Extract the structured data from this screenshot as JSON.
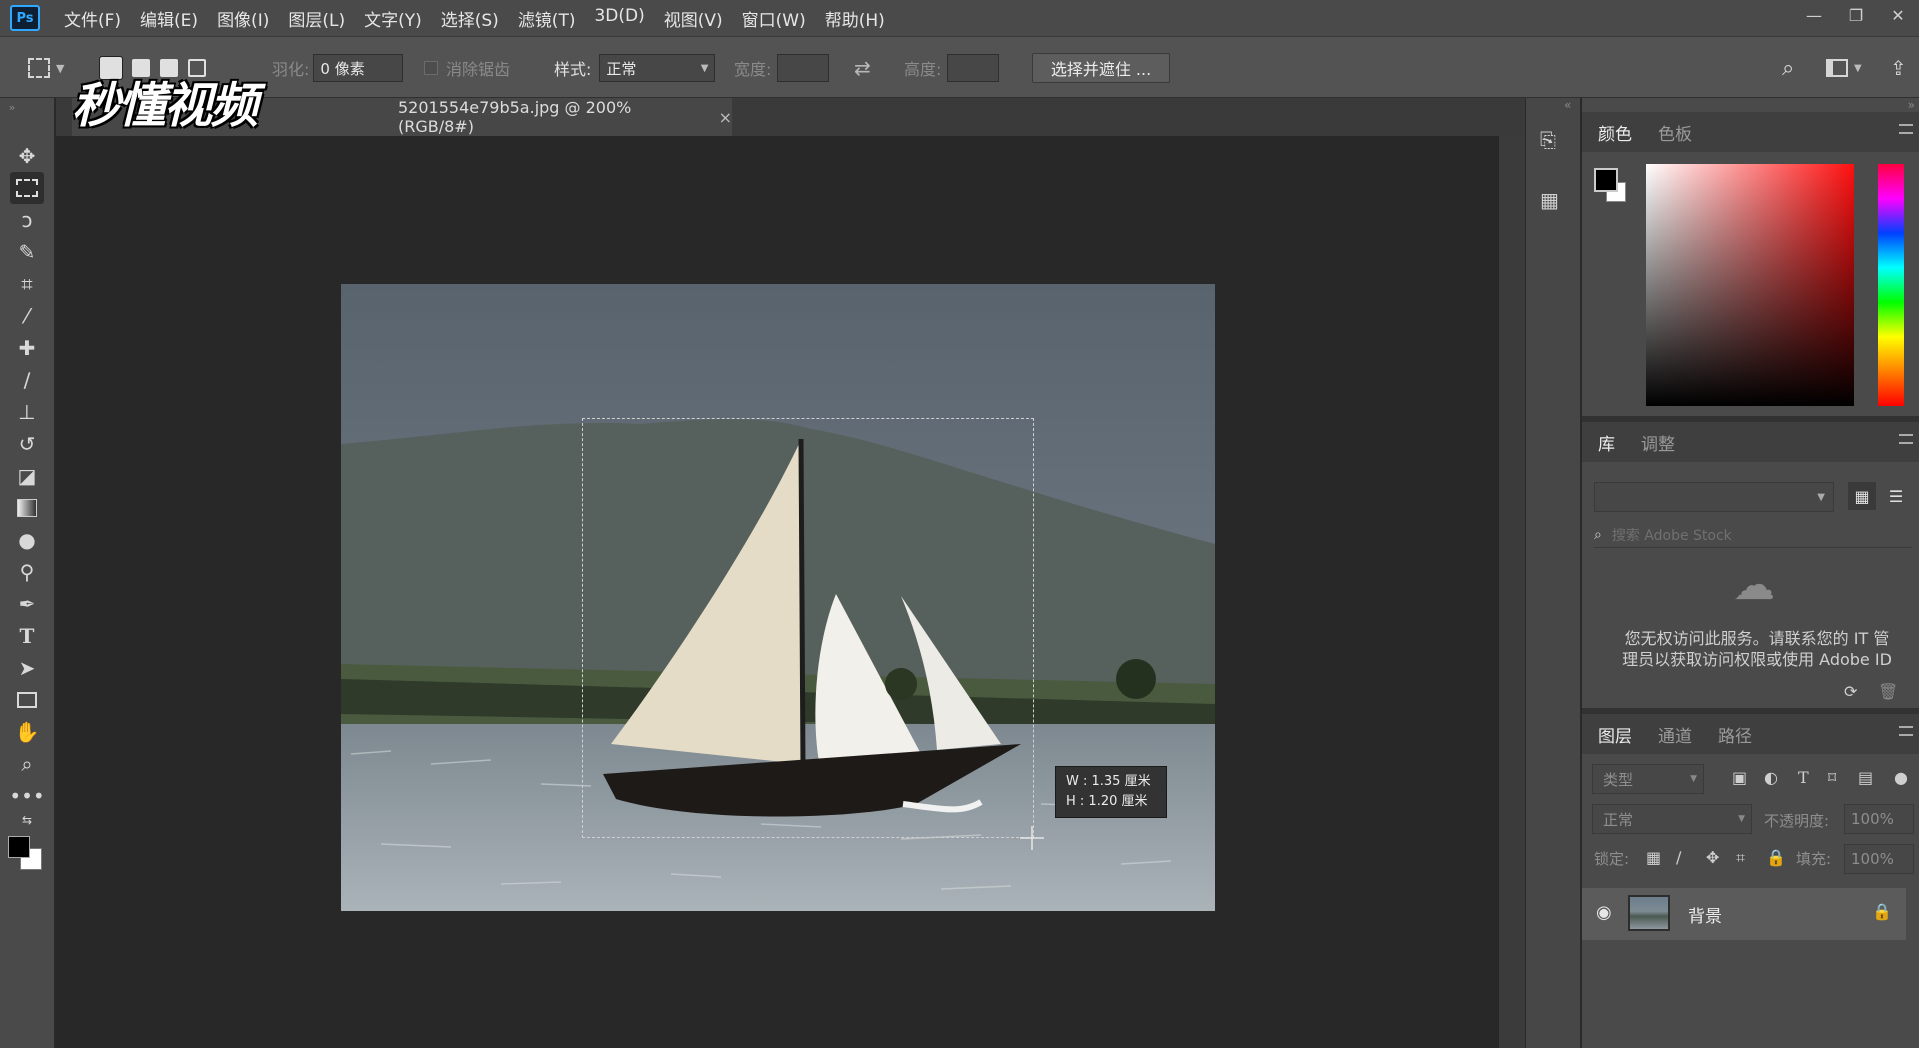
{
  "app": {
    "logo": "Ps"
  },
  "menu": [
    "文件(F)",
    "编辑(E)",
    "图像(I)",
    "图层(L)",
    "文字(Y)",
    "选择(S)",
    "滤镜(T)",
    "3D(D)",
    "视图(V)",
    "窗口(W)",
    "帮助(H)"
  ],
  "window_controls": {
    "minimize": "—",
    "restore": "❐",
    "close": "✕"
  },
  "options": {
    "feather_label": "羽化:",
    "feather_value": "0 像素",
    "antialias_label": "消除锯齿",
    "style_label": "样式:",
    "style_value": "正常",
    "width_label": "宽度:",
    "height_label": "高度:",
    "select_mask_button": "选择并遮住 ..."
  },
  "watermark": "秒懂视频",
  "document_tab": {
    "title": "5201554e79b5a.jpg @ 200%(RGB/8#)",
    "close": "×"
  },
  "size_tooltip": {
    "w": "W : 1.35 厘米",
    "h": "H : 1.20 厘米"
  },
  "color_panel": {
    "tabs": [
      "颜色",
      "色板"
    ]
  },
  "library_panel": {
    "tabs": [
      "库",
      "调整"
    ],
    "search_placeholder": "搜索 Adobe Stock",
    "message_line1": "您无权访问此服务。请联系您的 IT 管",
    "message_line2": "理员以获取访问权限或使用 Adobe ID"
  },
  "layers_panel": {
    "tabs": [
      "图层",
      "通道",
      "路径"
    ],
    "filter_label": "类型",
    "blend_mode": "正常",
    "opacity_label": "不透明度:",
    "opacity_value": "100%",
    "lock_label": "锁定:",
    "fill_label": "填充:",
    "fill_value": "100%",
    "layers": [
      {
        "name": "背景",
        "visible": true,
        "locked": true
      }
    ]
  },
  "colors": {
    "accent": "#31a8ff",
    "panel": "#4a4a4a",
    "canvas": "#282828"
  }
}
